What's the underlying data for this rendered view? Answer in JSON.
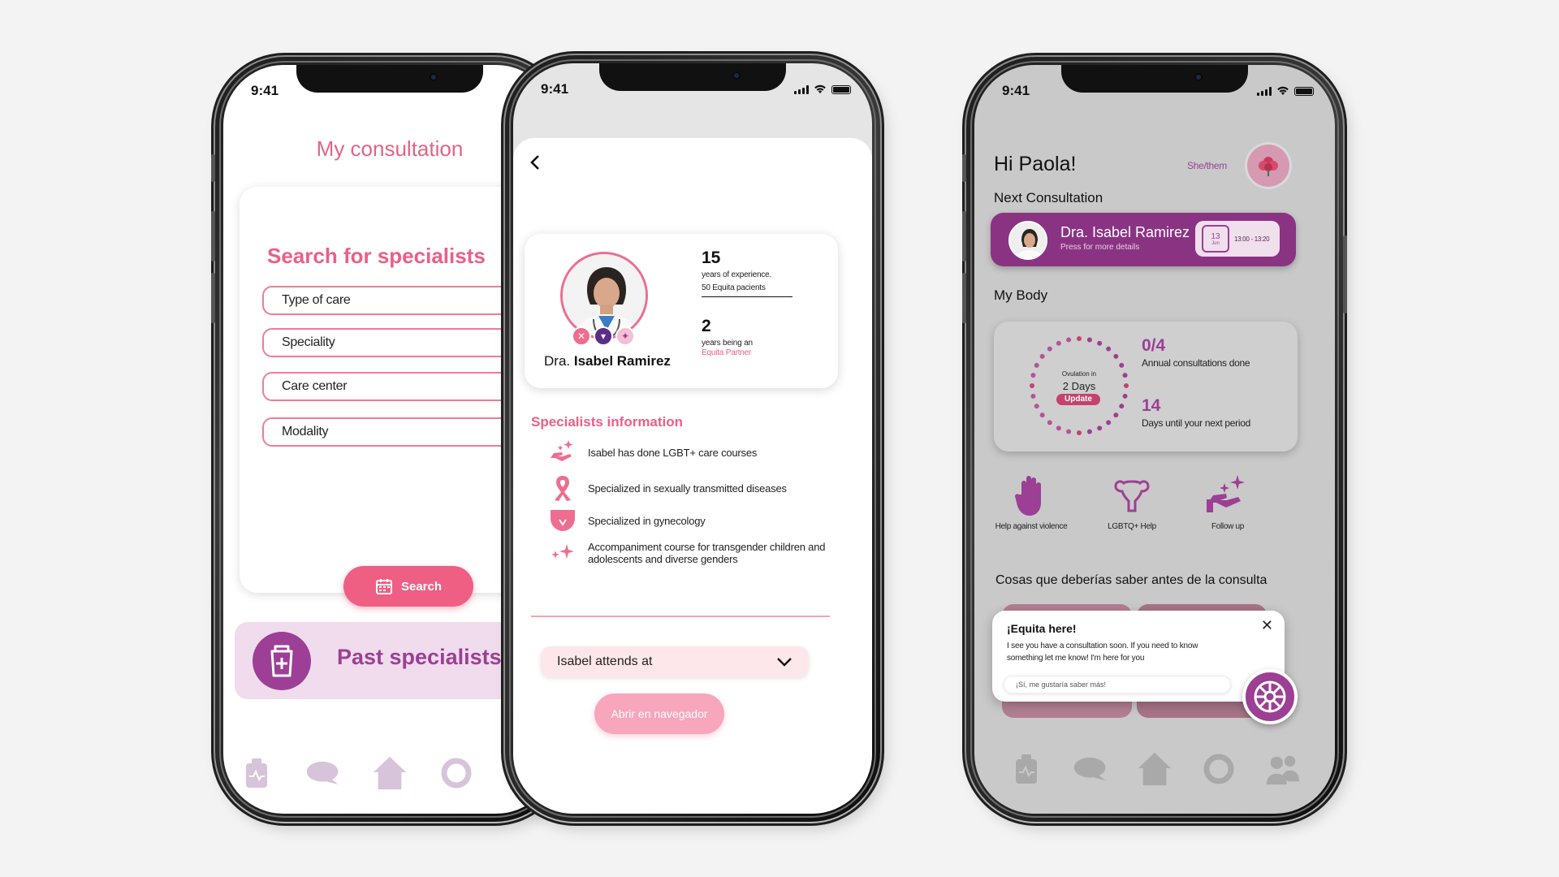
{
  "status_time": "9:41",
  "colors": {
    "pink": "#ef5f84",
    "light_pink": "#fde7ea",
    "purple": "#9c3f95",
    "dark_purple": "#8a3383",
    "icon_gray": "#d7c3da"
  },
  "consultation": {
    "title": "My consultation",
    "search_heading": "Search for specialists",
    "fields": [
      "Type of care",
      "Speciality",
      "Care center",
      "Modality"
    ],
    "search_button": "Search",
    "past_specialists": "Past specialists",
    "nav_icons": [
      "medical-bag-icon",
      "chat-icon",
      "home-icon",
      "circle-icon",
      "doctor-icon"
    ]
  },
  "specialist": {
    "name_prefix": "Dra.",
    "name": "Isabel Ramirez",
    "stat1_number": "15",
    "stat1_label": "years of experience.",
    "stat1_sub": "50 Equita pacients",
    "stat2_number": "2",
    "stat2_label": "years being an",
    "stat2_sub": "Equita Partner",
    "section_title": "Specialists information",
    "info": [
      {
        "icon": "care-hand-icon",
        "text": "Isabel has done LGBT+ care courses"
      },
      {
        "icon": "ribbon-icon",
        "text": "Specialized in sexually transmitted diseases"
      },
      {
        "icon": "uterus-underwear-icon",
        "text": "Specialized in gynecology"
      },
      {
        "icon": "sparkle-icon",
        "text": "Accompaniment course for transgender children and adolescents and diverse genders"
      }
    ],
    "attends_at": "Isabel attends at",
    "open_browser": "Abrir en navegador"
  },
  "home": {
    "greeting": "Hi Paola!",
    "pronouns": "She/them",
    "next_label": "Next Consultation",
    "next_doctor": "Dra. Isabel Ramirez",
    "next_sub": "Press for more details",
    "next_day": "13",
    "next_month": "Jun",
    "next_time": "13:00 - 13:20",
    "body_label": "My Body",
    "ovulation_label": "Ovulation in",
    "ovulation_days": "2 Days",
    "update": "Update",
    "stat1_number": "0/4",
    "stat1_label": "Annual consultations done",
    "stat2_number": "14",
    "stat2_label": "Days until your next period",
    "actions": [
      "Help against violence",
      "LGBTQ+ Help",
      "Follow up"
    ],
    "know_before": "Cosas que deberías saber antes de la consulta",
    "chat_title": "¡Equita here!",
    "chat_message": "I see you have a consultation soon. If you need to know something let me know! I'm here for you",
    "chat_reply": "¡Sí, me gustaría saber más!"
  }
}
